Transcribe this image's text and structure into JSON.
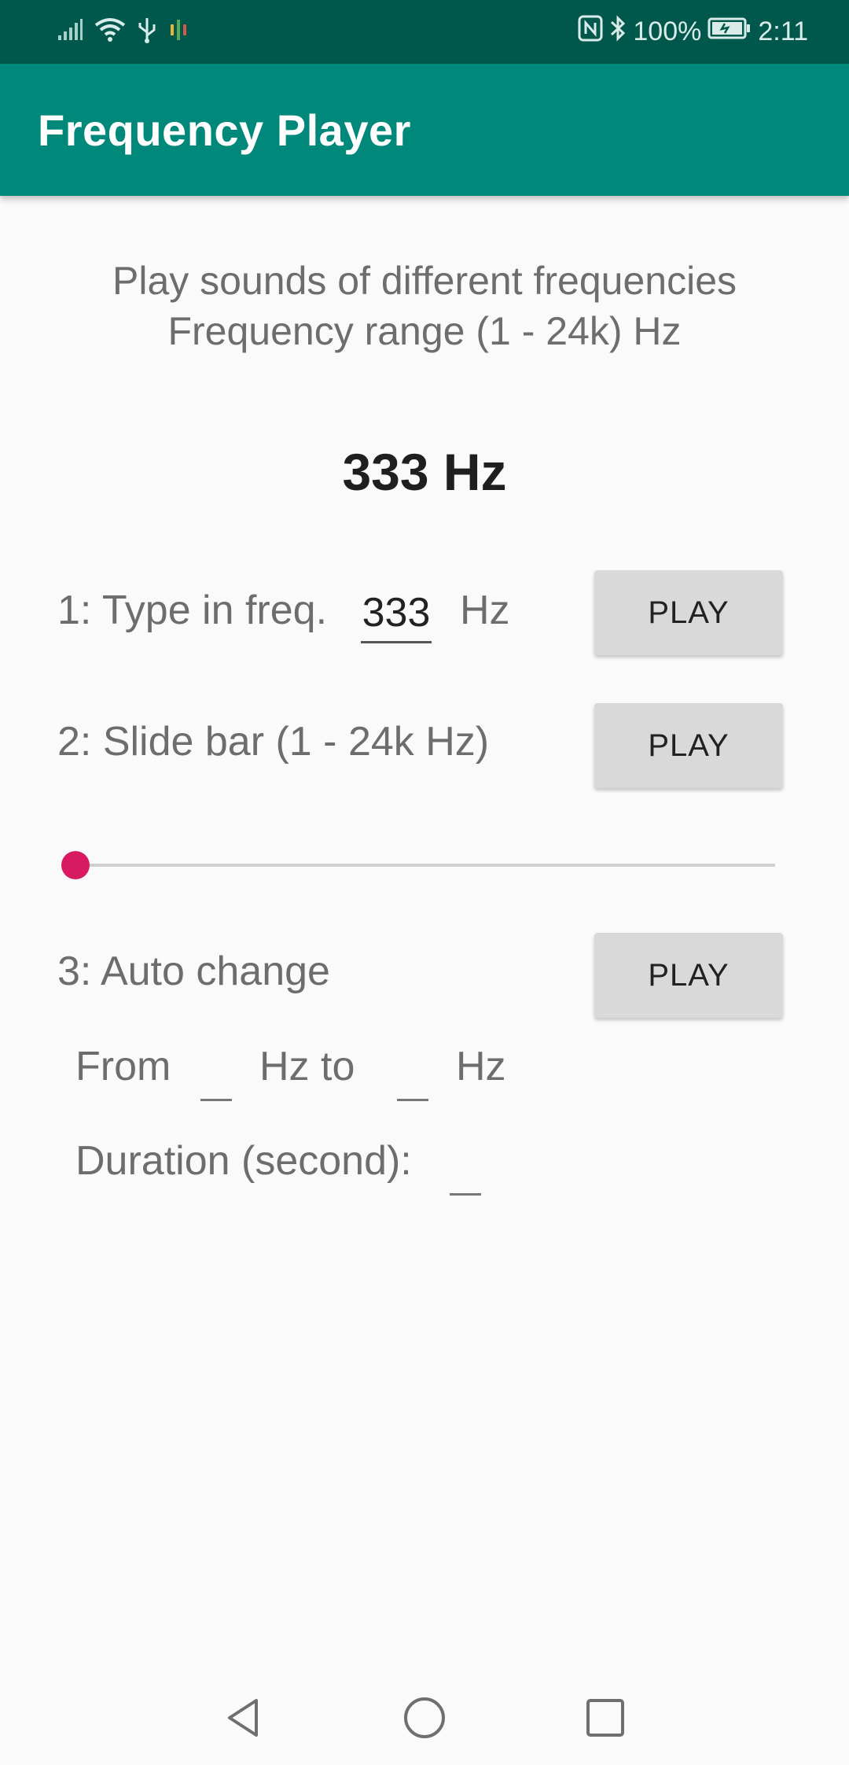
{
  "status_bar": {
    "battery_text": "100%",
    "time": "2:11",
    "icons": [
      "signal-icon",
      "wifi-icon",
      "usb-icon",
      "notification-icon",
      "nfc-icon",
      "bluetooth-icon",
      "battery-icon"
    ]
  },
  "app_bar": {
    "title": "Frequency Player"
  },
  "intro": {
    "line1": "Play sounds of different frequencies",
    "line2": "Frequency range (1 - 24k) Hz"
  },
  "current_frequency": "333 Hz",
  "section1": {
    "label": "1: Type in freq.",
    "input_value": "333",
    "unit": "Hz",
    "play_label": "PLAY"
  },
  "section2": {
    "label": "2: Slide bar (1 - 24k Hz)",
    "play_label": "PLAY",
    "slider_fraction": 0.0
  },
  "section3": {
    "label": "3: Auto change",
    "play_label": "PLAY",
    "from_label": "From",
    "hz_to_label": "Hz to",
    "hz_label": "Hz",
    "from_value": "",
    "to_value": "",
    "duration_label": "Duration (second):",
    "duration_value": ""
  },
  "colors": {
    "status_bar": "#00574b",
    "app_bar": "#00897b",
    "accent": "#d81b60",
    "button": "#d9d9d9"
  },
  "nav_bar": {
    "icons": [
      "back-icon",
      "home-icon",
      "recents-icon"
    ]
  }
}
